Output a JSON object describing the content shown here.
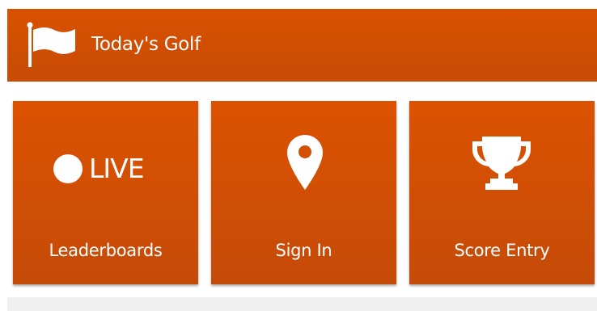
{
  "header": {
    "title": "Today's Golf",
    "icon": "flag-icon"
  },
  "tiles": [
    {
      "icon": "live-indicator-icon",
      "icon_text": "LIVE",
      "label": "Leaderboards"
    },
    {
      "icon": "location-pin-icon",
      "label": "Sign In"
    },
    {
      "icon": "trophy-icon",
      "label": "Score Entry"
    }
  ],
  "colors": {
    "brand_orange": "#d95100",
    "text": "#ffffff",
    "bottom_bar": "#f0f0f0"
  }
}
